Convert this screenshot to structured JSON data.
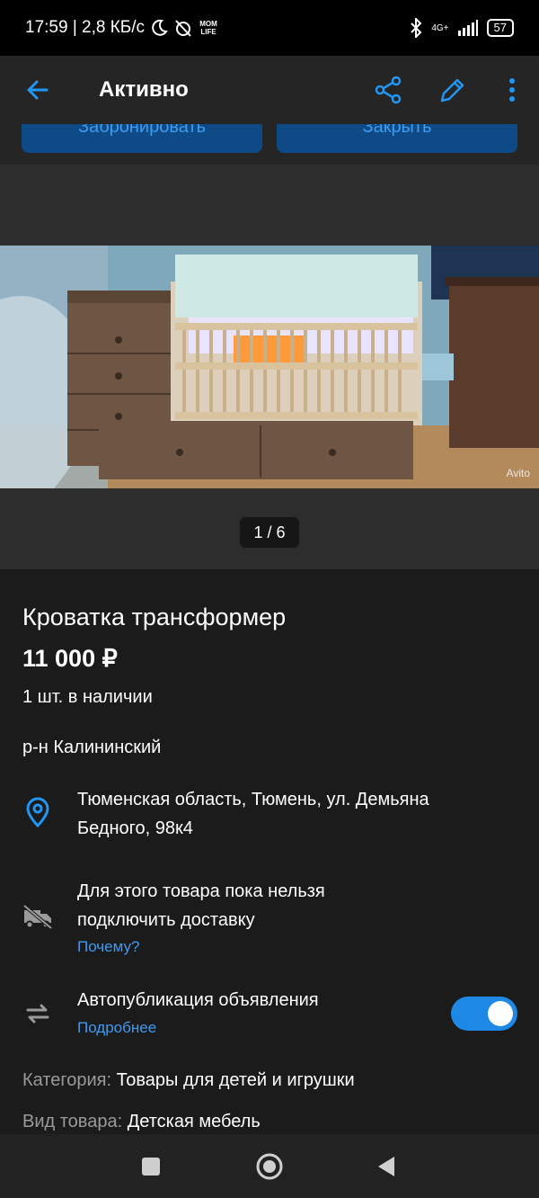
{
  "status_bar": {
    "time_speed": "17:59 | 2,8 КБ/с",
    "app_badge": "MOM LIFE",
    "network": "4G+",
    "battery": "57"
  },
  "app_bar": {
    "title": "Активно",
    "icons": [
      "back-arrow-icon",
      "share-icon",
      "edit-pencil-icon",
      "more-vert-icon"
    ],
    "accent": "#2196f3"
  },
  "actions": {
    "reserve_label": "Забронировать",
    "close_label": "Закрыть"
  },
  "gallery": {
    "counter": "1 / 6",
    "watermark": "Avito"
  },
  "listing": {
    "title": "Кроватка трансформер",
    "price": "11 000 ₽",
    "stock": "1 шт. в наличии",
    "district": "р-н Калининский",
    "address_line1": "Тюменская область, Тюмень, ул. Демьяна",
    "address_line2": "Бедного, 98к4",
    "delivery_line1": "Для этого товара пока нельзя",
    "delivery_line2": "подключить доставку",
    "delivery_link": "Почему?",
    "autopublish_label": "Автопубликация объявления",
    "autopublish_link": "Подробнее",
    "autopublish_on": true,
    "category_key": "Категория:",
    "category_value": "Товары для детей и игрушки",
    "type_key": "Вид товара:",
    "type_value": "Детская мебель"
  },
  "nav_bar": {
    "icons": [
      "recents-square-icon",
      "home-circle-icon",
      "back-triangle-icon"
    ]
  }
}
